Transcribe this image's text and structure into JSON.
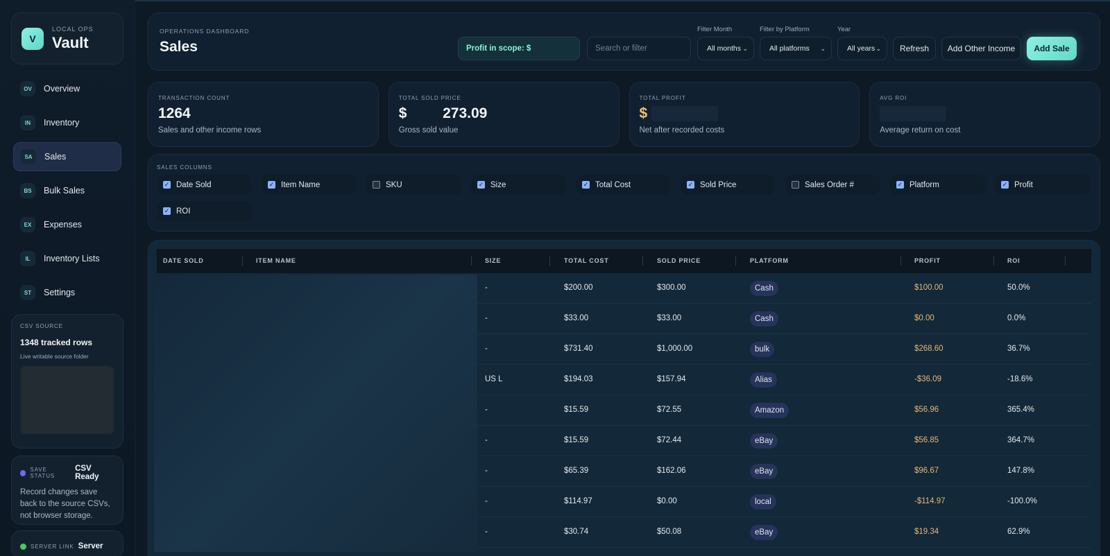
{
  "brand": {
    "logo": "V",
    "kicker": "LOCAL OPS",
    "name": "Vault"
  },
  "nav": [
    {
      "badge": "OV",
      "label": "Overview"
    },
    {
      "badge": "IN",
      "label": "Inventory"
    },
    {
      "badge": "SA",
      "label": "Sales",
      "active": true
    },
    {
      "badge": "BS",
      "label": "Bulk Sales"
    },
    {
      "badge": "EX",
      "label": "Expenses"
    },
    {
      "badge": "IL",
      "label": "Inventory Lists"
    },
    {
      "badge": "ST",
      "label": "Settings"
    }
  ],
  "csv_source": {
    "kicker": "CSV SOURCE",
    "rows": "1348 tracked rows",
    "sub": "Live writable source folder"
  },
  "save_status": {
    "kicker": "SAVE STATUS",
    "status": "CSV Ready",
    "text": "Record changes save back to the source CSVs, not browser storage."
  },
  "server_link": {
    "kicker": "SERVER LINK",
    "status": "Server"
  },
  "header": {
    "kicker": "OPERATIONS DASHBOARD",
    "title": "Sales",
    "profit_in_scope": "Profit in scope: $",
    "search_placeholder": "Search or filter",
    "filter_month_label": "Filter Month",
    "filter_month_value": "All months",
    "filter_platform_label": "Filter by Platform",
    "filter_platform_value": "All platforms",
    "year_label": "Year",
    "year_value": "All years",
    "refresh": "Refresh",
    "add_other_income": "Add Other Income",
    "add_sale": "Add Sale"
  },
  "stats": [
    {
      "kicker": "TRANSACTION COUNT",
      "value": "1264",
      "sub": "Sales and other income rows"
    },
    {
      "kicker": "TOTAL SOLD PRICE",
      "value_prefix": "$",
      "value_suffix": "273.09",
      "sub": "Gross sold value"
    },
    {
      "kicker": "TOTAL PROFIT",
      "value_prefix": "$",
      "sub": "Net after recorded costs"
    },
    {
      "kicker": "AVG ROI",
      "sub": "Average return on cost"
    }
  ],
  "columns_panel": {
    "kicker": "SALES COLUMNS",
    "columns": [
      {
        "label": "Date Sold",
        "checked": true
      },
      {
        "label": "Item Name",
        "checked": true
      },
      {
        "label": "SKU",
        "checked": false
      },
      {
        "label": "Size",
        "checked": true
      },
      {
        "label": "Total Cost",
        "checked": true
      },
      {
        "label": "Sold Price",
        "checked": true
      },
      {
        "label": "Sales Order #",
        "checked": false
      },
      {
        "label": "Platform",
        "checked": true
      },
      {
        "label": "Profit",
        "checked": true
      },
      {
        "label": "ROI",
        "checked": true
      }
    ]
  },
  "table": {
    "headers": [
      "DATE SOLD",
      "ITEM NAME",
      "SIZE",
      "TOTAL COST",
      "SOLD PRICE",
      "PLATFORM",
      "PROFIT",
      "ROI"
    ],
    "rows": [
      {
        "size": "-",
        "cost": "$200.00",
        "sold": "$300.00",
        "platform": "Cash",
        "profit": "$100.00",
        "roi": "50.0%"
      },
      {
        "size": "-",
        "cost": "$33.00",
        "sold": "$33.00",
        "platform": "Cash",
        "profit": "$0.00",
        "roi": "0.0%"
      },
      {
        "size": "-",
        "cost": "$731.40",
        "sold": "$1,000.00",
        "platform": "bulk",
        "profit": "$268.60",
        "roi": "36.7%"
      },
      {
        "size": "US L",
        "cost": "$194.03",
        "sold": "$157.94",
        "platform": "Alias",
        "profit": "-$36.09",
        "roi": "-18.6%"
      },
      {
        "size": "-",
        "cost": "$15.59",
        "sold": "$72.55",
        "platform": "Amazon",
        "profit": "$56.96",
        "roi": "365.4%"
      },
      {
        "size": "-",
        "cost": "$15.59",
        "sold": "$72.44",
        "platform": "eBay",
        "profit": "$56.85",
        "roi": "364.7%"
      },
      {
        "size": "-",
        "cost": "$65.39",
        "sold": "$162.06",
        "platform": "eBay",
        "profit": "$96.67",
        "roi": "147.8%"
      },
      {
        "size": "-",
        "cost": "$114.97",
        "sold": "$0.00",
        "platform": "local",
        "profit": "-$114.97",
        "roi": "-100.0%"
      },
      {
        "size": "-",
        "cost": "$30.74",
        "sold": "$50.08",
        "platform": "eBay",
        "profit": "$19.34",
        "roi": "62.9%"
      }
    ]
  }
}
